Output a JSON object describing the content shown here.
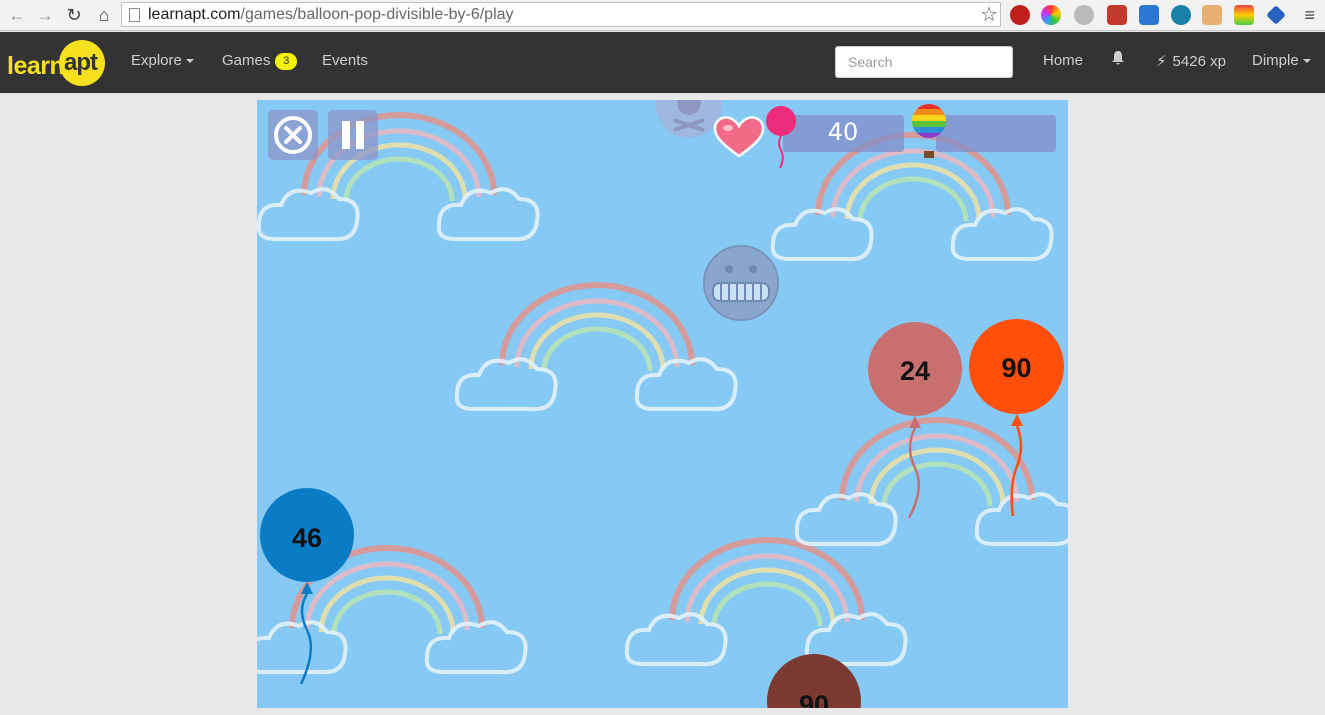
{
  "browser": {
    "url_host": "learnapt.com",
    "url_path": "/games/balloon-pop-divisible-by-6/play"
  },
  "navbar": {
    "logo_text": "learn",
    "logo_badge_text": "apt",
    "explore_label": "Explore",
    "games_label": "Games",
    "games_badge": "3",
    "events_label": "Events",
    "search_placeholder": "Search",
    "home_label": "Home",
    "xp_label": "5426 xp",
    "user_label": "Dimple"
  },
  "game": {
    "score": "40",
    "balloons": [
      {
        "label": "24",
        "color": "#c87070"
      },
      {
        "label": "90",
        "color": "#ff4f0a"
      },
      {
        "label": "46",
        "color": "#0a7cc6"
      },
      {
        "label": "90",
        "color": "#7a3a32"
      }
    ],
    "icons": [
      "close-icon",
      "pause-icon",
      "skull-icon",
      "heart-icon",
      "balloon-icon",
      "hot-air-balloon-icon",
      "frozen-face-icon"
    ],
    "colors": {
      "sky": "#87c9f5",
      "hud": "#8c96c8"
    }
  }
}
